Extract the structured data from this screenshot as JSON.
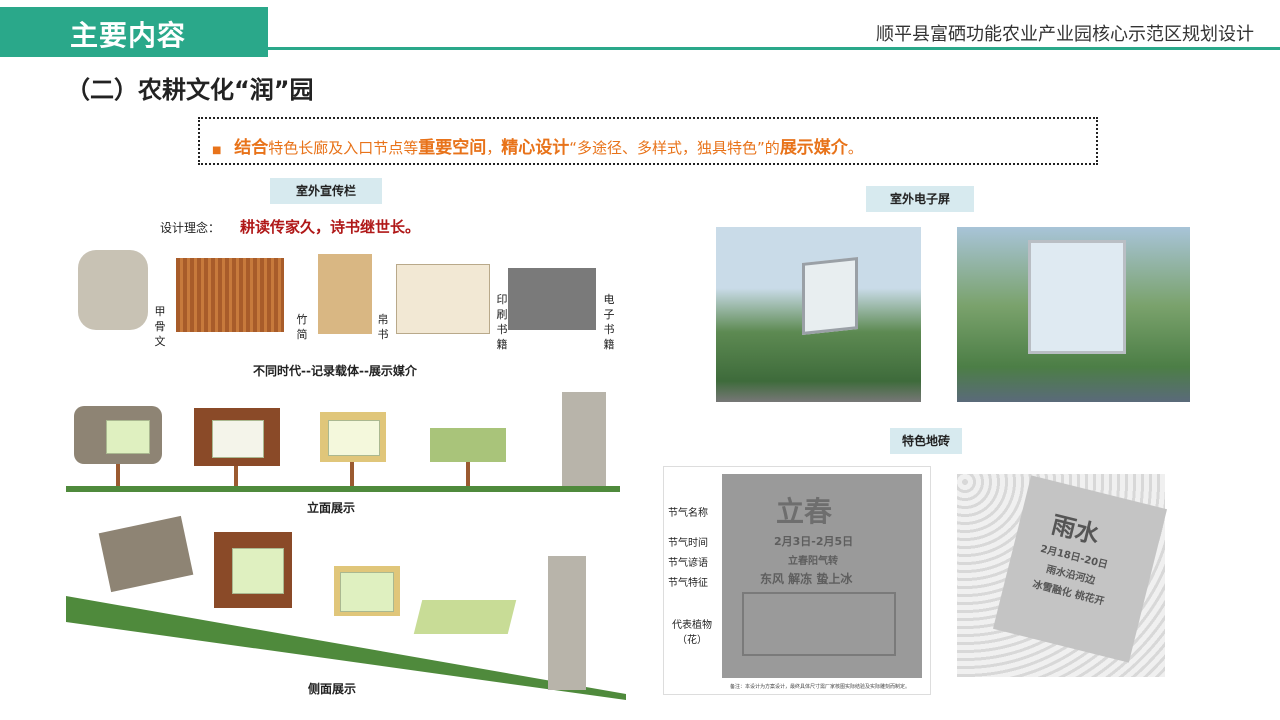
{
  "header": {
    "tag": "主要内容",
    "project": "顺平县富硒功能农业产业园核心示范区规划设计"
  },
  "section_title": "（二）农耕文化“润”园",
  "banner": {
    "bullet": "■",
    "parts": [
      {
        "text": "结合",
        "bold": true
      },
      {
        "text": "特色长廊及入口节点等",
        "bold": false
      },
      {
        "text": "重要空间",
        "bold": true
      },
      {
        "text": "，",
        "bold": false
      },
      {
        "text": "精心设计",
        "bold": true
      },
      {
        "text": "“多途径、多样式，独具特色”的",
        "bold": false
      },
      {
        "text": "展示媒介",
        "bold": true
      },
      {
        "text": "。",
        "bold": false
      }
    ]
  },
  "left": {
    "chip": "室外宣传栏",
    "concept_label": "设计理念：",
    "concept_text": "耕读传家久，诗书继世长。",
    "media": [
      "甲骨文",
      "竹简",
      "帛书",
      "印刷书籍",
      "电子书籍"
    ],
    "timeline_caption": "不同时代--记录载体--展示媒介",
    "front_caption": "立面展示",
    "side_caption": "侧面展示"
  },
  "right": {
    "screen_chip": "室外电子屏",
    "tile_chip": "特色地砖",
    "tile_labels": [
      "节气名称",
      "节气时间",
      "节气谚语",
      "节气特征",
      "代表植物（花）"
    ],
    "tile_big": "立春",
    "tile_date": "2月3日-2月5日",
    "tile_saying": "立春阳气转",
    "tile_feature": "东风  解冻  蛰上冰",
    "tile_note": "备注：本设计为方案设计，最终具体尺寸需厂家核图实际结验及实际雕刻而制定。",
    "tile2_big": "雨水",
    "tile2_date": "2月18日-20日",
    "tile2_line1": "雨水沿河边",
    "tile2_line2": "冰雪融化 桃花开"
  },
  "colors": {
    "accent": "#2aa88a",
    "orange": "#e8731a",
    "chip": "#d7eaef",
    "red": "#b01818"
  }
}
